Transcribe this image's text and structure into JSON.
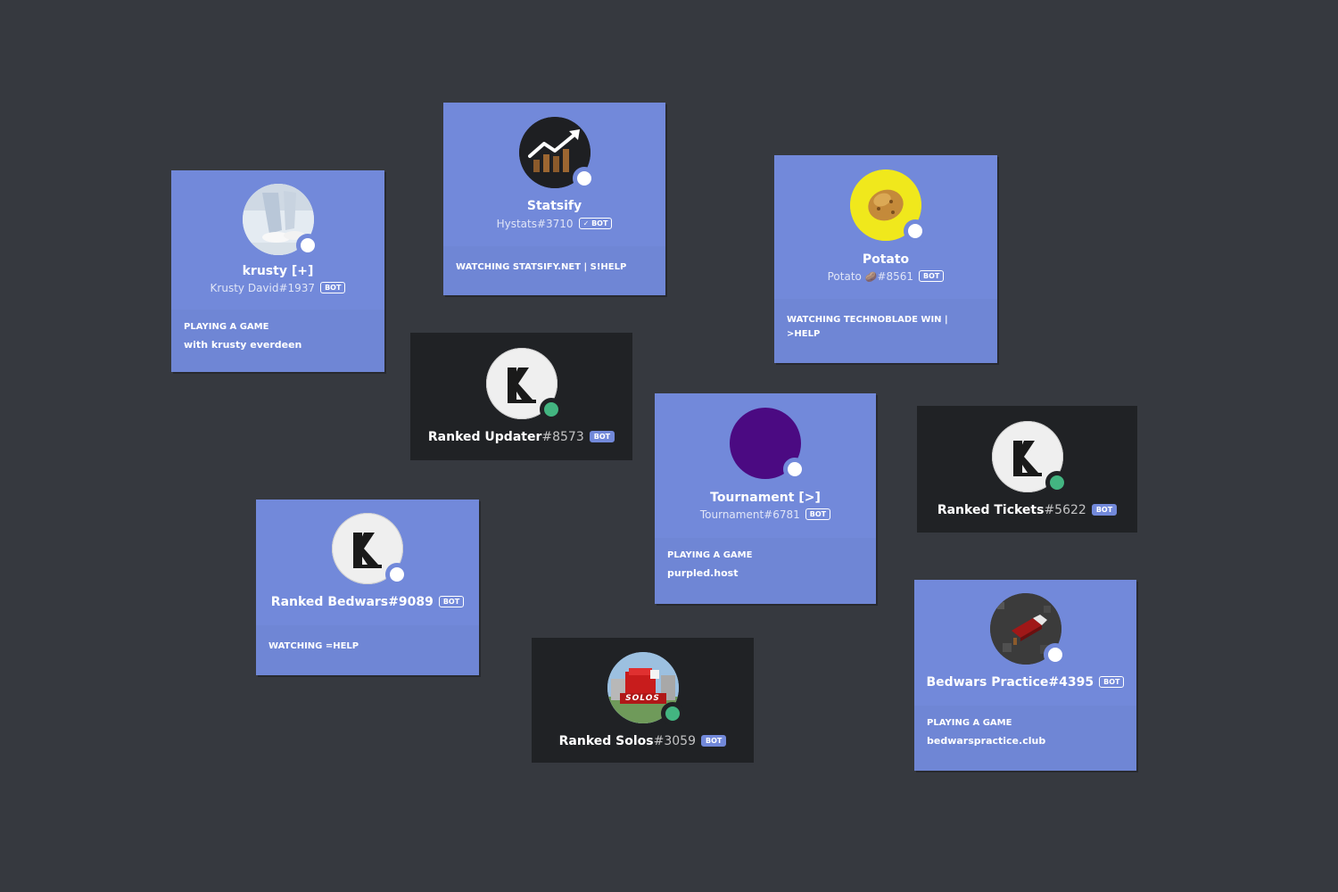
{
  "cards": {
    "krusty": {
      "display_name": "krusty [+]",
      "tag": "Krusty David#1937",
      "badge": "BOT",
      "activity_header": "PLAYING A GAME",
      "activity_value": "with krusty everdeen"
    },
    "statsify": {
      "display_name": "Statsify",
      "tag": "Hystats#3710",
      "badge": "✓ BOT",
      "activity_header": "WATCHING STATSIFY.NET | S!HELP"
    },
    "potato": {
      "display_name": "Potato",
      "tag_prefix": "Potato",
      "tag_emoji": "🥔",
      "tag_suffix": "#8561",
      "badge": "BOT",
      "activity_header": "WATCHING TECHNOBLADE WIN | >HELP"
    },
    "ranked_updater": {
      "name": "Ranked Updater",
      "discriminator": "#8573",
      "badge": "BOT"
    },
    "tournament": {
      "display_name": "Tournament [>]",
      "tag": "Tournament#6781",
      "badge": "BOT",
      "activity_header": "PLAYING A GAME",
      "activity_value": "purpled.host"
    },
    "ranked_tickets": {
      "name": "Ranked Tickets",
      "discriminator": "#5622",
      "badge": "BOT"
    },
    "ranked_bedwars": {
      "name": "Ranked Bedwars",
      "discriminator": "#9089",
      "badge": "BOT",
      "activity_header": "WATCHING =HELP"
    },
    "ranked_solos": {
      "name": "Ranked Solos",
      "discriminator": "#3059",
      "badge": "BOT",
      "avatar_text": "SOLOS"
    },
    "bedwars_practice": {
      "name": "Bedwars Practice",
      "discriminator": "#4395",
      "badge": "BOT",
      "activity_header": "PLAYING A GAME",
      "activity_value": "bedwarspractice.club"
    }
  },
  "colors": {
    "background": "#36393f",
    "blurple": "#7289da",
    "dark_card": "#202225",
    "online": "#43b581",
    "tournament_avatar": "#4b0a82",
    "potato_avatar": "#f0e81c"
  },
  "icons": {
    "status_online": "online-status-icon",
    "status_offline": "status-dot-icon"
  }
}
